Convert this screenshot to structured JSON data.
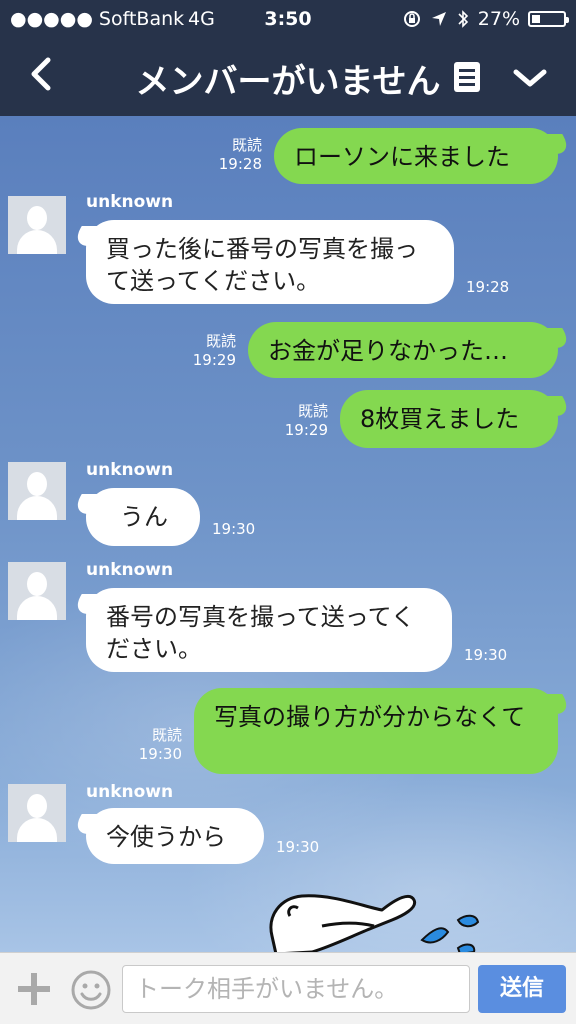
{
  "status_bar": {
    "carrier": "●●●●● SoftBank",
    "network": "4G",
    "time": "3:50",
    "battery": "27%",
    "battery_level": 0.27
  },
  "header": {
    "title": "メンバーがいません",
    "back_icon": "chevron-left-icon",
    "menu_icon": "list-icon",
    "expand_icon": "chevron-down-icon"
  },
  "messages": [
    {
      "dir": "out",
      "text": "ローソンに来ました",
      "read": "既読",
      "time": "19:28"
    },
    {
      "dir": "in",
      "sender": "unknown",
      "text": "買った後に番号の写真を撮って送ってください。",
      "time": "19:28"
    },
    {
      "dir": "out",
      "text": "お金が足りなかった…",
      "read": "既読",
      "time": "19:29"
    },
    {
      "dir": "out",
      "text": "8枚買えました",
      "read": "既読",
      "time": "19:29"
    },
    {
      "dir": "in",
      "sender": "unknown",
      "text": "うん",
      "time": "19:30"
    },
    {
      "dir": "in",
      "sender": "unknown",
      "text": "番号の写真を撮って送ってください。",
      "time": "19:30"
    },
    {
      "dir": "out",
      "text": "写真の撮り方が分からなくて",
      "read": "既読",
      "time": "19:30"
    },
    {
      "dir": "in",
      "sender": "unknown",
      "text": "今使うから",
      "time": "19:30"
    }
  ],
  "input": {
    "placeholder": "トーク相手がいません。",
    "send_label": "送信"
  },
  "colors": {
    "header_bg": "#27334a",
    "out_bubble": "#84d850",
    "in_bubble": "#ffffff",
    "send_button": "#5a8ee0"
  }
}
